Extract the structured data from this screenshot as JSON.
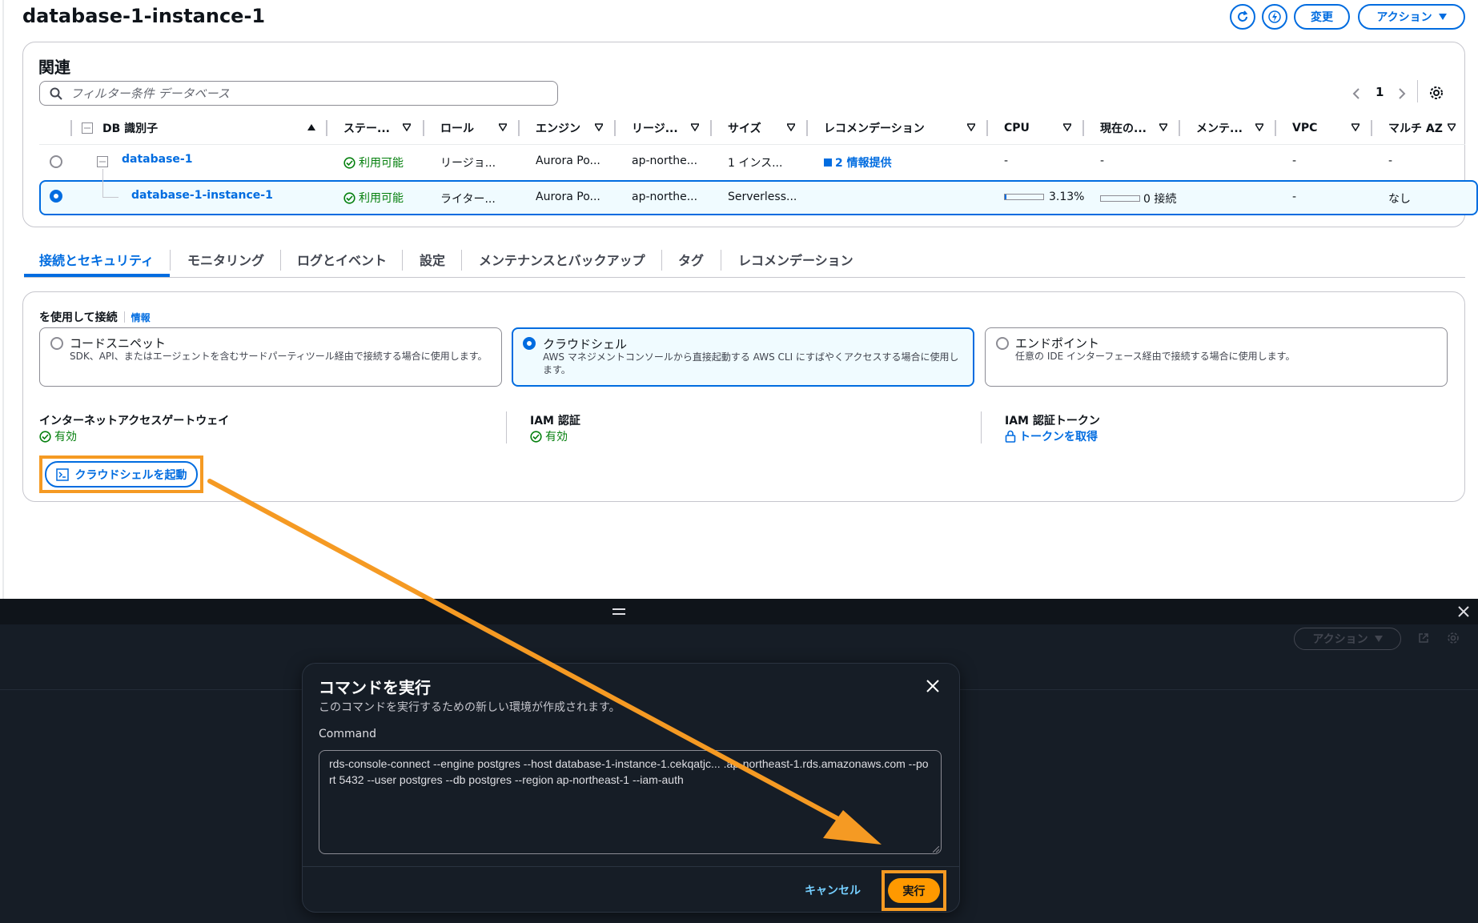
{
  "header": {
    "title": "database-1-instance-1",
    "modify_label": "変更",
    "actions_label": "アクション"
  },
  "related": {
    "title": "関連",
    "search_placeholder": "フィルター条件 データベース",
    "page": "1",
    "columns": [
      "DB 識別子",
      "ステー...",
      "ロール",
      "エンジン",
      "リージ...",
      "サイズ",
      "レコメンデーション",
      "CPU",
      "現在の...",
      "メンテ...",
      "VPC",
      "マルチ AZ"
    ],
    "rows": [
      {
        "id": "database-1",
        "status": "利用可能",
        "role": "リージョ...",
        "engine": "Aurora Po...",
        "region": "ap-northe...",
        "size": "1 インス...",
        "recommendation": "2 情報提供",
        "cpu": "-",
        "current": "-",
        "maint": "-",
        "vpc": "-"
      },
      {
        "id": "database-1-instance-1",
        "status": "利用可能",
        "role": "ライター...",
        "engine": "Aurora Po...",
        "region": "ap-northe...",
        "size": "Serverless...",
        "cpu": "3.13%",
        "cpu_fraction": 0.0313,
        "current": "0 接続",
        "vpc": "-",
        "multi_az": "なし"
      }
    ]
  },
  "tabs": [
    "接続とセキュリティ",
    "モニタリング",
    "ログとイベント",
    "設定",
    "メンテナンスとバックアップ",
    "タグ",
    "レコメンデーション"
  ],
  "connect": {
    "label": "を使用して接続",
    "info": "情報",
    "options": [
      {
        "title": "コードスニペット",
        "desc": "SDK、API、またはエージェントを含むサードパーティツール経由で接続する場合に使用します。"
      },
      {
        "title": "クラウドシェル",
        "desc": "AWS マネジメントコンソールから直接起動する AWS CLI にすばやくアクセスする場合に使用します。"
      },
      {
        "title": "エンドポイント",
        "desc": "任意の IDE インターフェース経由で接続する場合に使用します。"
      }
    ],
    "igw_label": "インターネットアクセスゲートウェイ",
    "igw_value": "有効",
    "iam_label": "IAM 認証",
    "iam_value": "有効",
    "token_label": "IAM 認証トークン",
    "token_value": "トークンを取得",
    "launch_label": "クラウドシェルを起動"
  },
  "shell": {
    "actions_label": "アクション"
  },
  "modal": {
    "title": "コマンドを実行",
    "subtitle": "このコマンドを実行するための新しい環境が作成されます。",
    "command_label": "Command",
    "command": "rds-console-connect --engine postgres --host database-1-instance-1.cekqatjc... .ap-northeast-1.rds.amazonaws.com --port 5432 --user postgres --db postgres --region ap-northeast-1 --iam-auth",
    "cancel": "キャンセル",
    "run": "実行"
  },
  "colors": {
    "accent": "#006ce0",
    "success": "#037f0c",
    "highlight": "#f59a23",
    "primary_button": "#ff9900",
    "shell_bg": "#161d26"
  }
}
